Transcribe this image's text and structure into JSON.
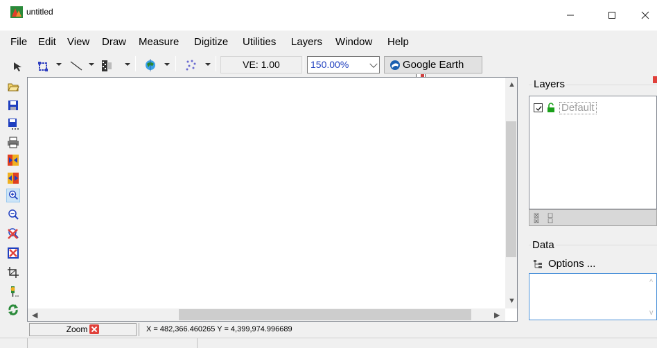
{
  "window": {
    "title": "untitled",
    "controls": {
      "minimize": "—",
      "maximize": "☐",
      "close": "✕"
    }
  },
  "menu": {
    "items": [
      "File",
      "Edit",
      "View",
      "Draw",
      "Measure",
      "Digitize",
      "Utilities",
      "Layers",
      "Window",
      "Help"
    ]
  },
  "toolbar": {
    "ve_label": "VE: 1.00",
    "zoom_value": "150.00%",
    "google_earth_label": "Google Earth",
    "icons": [
      "select-arrow-icon",
      "select-rect-icon",
      "draw-line-icon",
      "bitmap-grid-icon",
      "globe-icon",
      "point-scatter-icon"
    ]
  },
  "left_toolbar": {
    "icons": [
      "open-folder-icon",
      "save-icon",
      "save-as-icon",
      "print-icon",
      "zoom-extents-icon",
      "zoom-width-icon",
      "zoom-in-icon",
      "zoom-out-icon",
      "zoom-cancel-icon",
      "zoom-box-icon",
      "crop-icon",
      "digitize-pin-icon",
      "rotate-icon"
    ],
    "active": "zoom-in-icon"
  },
  "layers_panel": {
    "title": "Layers",
    "items": [
      {
        "name": "Default",
        "checked": true,
        "locked": false
      }
    ]
  },
  "data_panel": {
    "title": "Data",
    "options_label": "Options ..."
  },
  "status": {
    "mode_label": "Zoom",
    "coords": "X = 482,366.460265  Y = 4,399,974.996689"
  },
  "colors": {
    "accent_blue": "#1f3fbf",
    "lock_green": "#1aa01a",
    "cancel_red": "#e0403a"
  }
}
